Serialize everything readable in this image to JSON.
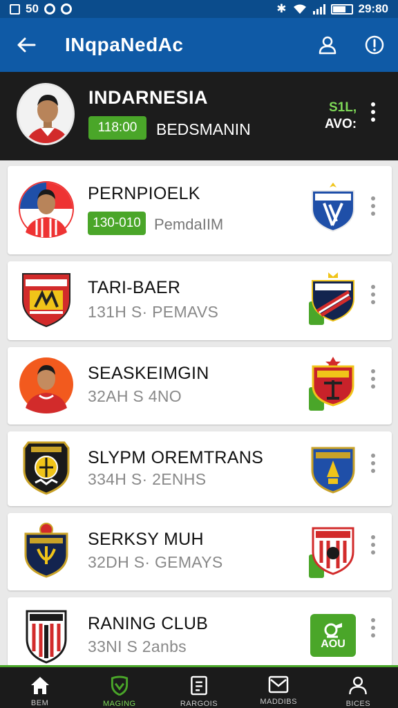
{
  "status_bar": {
    "left_text": "50",
    "time": "29:80"
  },
  "app_bar": {
    "title": "INqpaNedAc"
  },
  "header": {
    "name": "INDARNESIA",
    "score": "118:00",
    "subtitle": "BEDSMANIN",
    "stat_top": "S1L,",
    "stat_bottom": "AVO:"
  },
  "items": [
    {
      "title": "PERNPIOELK",
      "badge": "130-010",
      "subtitle": "PemdaIIM"
    },
    {
      "title": "TARI-BAER",
      "subtitle": "131H S· PEMAVS"
    },
    {
      "title": "SEASKEIMGIN",
      "subtitle": "32AH S 4NO"
    },
    {
      "title": "SLYPM OREMTRANS",
      "subtitle": "334H S· 2ENHS"
    },
    {
      "title": "SERKSY MUH",
      "subtitle": "32DH S· GEMAYS"
    },
    {
      "title": "RANING CLUB",
      "subtitle": "33NI S 2anbs",
      "add_label": "AOU"
    }
  ],
  "bottom_nav": [
    {
      "label": "BEM"
    },
    {
      "label": "MAGING"
    },
    {
      "label": "RARGOIS"
    },
    {
      "label": "MADDIBS"
    },
    {
      "label": "BICES"
    }
  ],
  "colors": {
    "primary": "#0f5aa6",
    "status": "#0b4c8c",
    "accent": "#4aa629",
    "dark": "#1c1c1c"
  }
}
